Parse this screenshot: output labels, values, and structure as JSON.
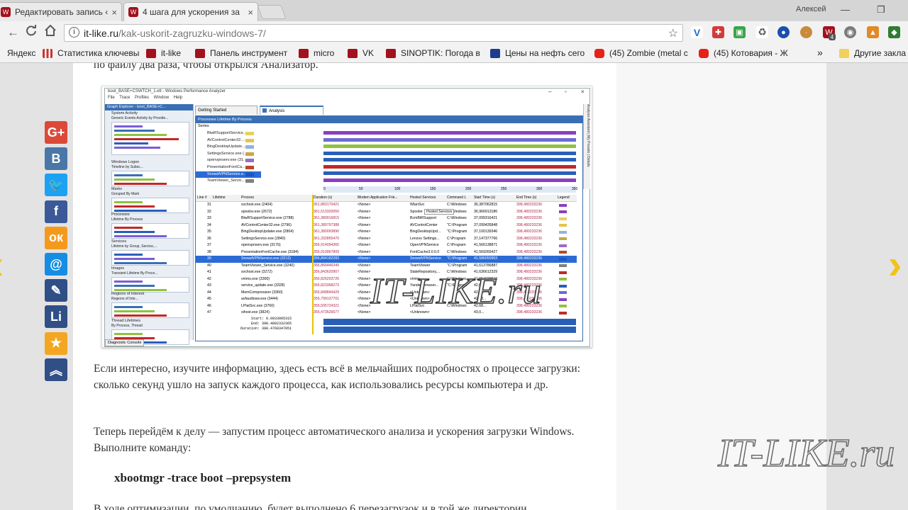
{
  "tabs": [
    {
      "title": "Редактировать запись ‹",
      "close": "×"
    },
    {
      "title": "4 шага для ускорения за",
      "close": "×"
    }
  ],
  "user": "Алексей",
  "window_controls": {
    "minimize": "—",
    "maximize": "❐"
  },
  "toolbar": {
    "back": "←",
    "forward": "→",
    "reload": "C",
    "home": "⌂",
    "url_host": "it-like.ru",
    "url_path": "/kak-uskorit-zagruzku-windows-7/",
    "star": "☆"
  },
  "extensions": [
    "vpn-extension",
    "shield-extension",
    "green-extension",
    "recycle-extension",
    "globe-extension",
    "cookie-extension",
    "badge-extension",
    "eye-extension",
    "fox-extension",
    "puzzle-extension",
    "menu"
  ],
  "ext_badge": "4",
  "bookmarks": [
    {
      "label": "Яндекс",
      "icon": "none"
    },
    {
      "label": "Статистика ключевы",
      "icon": "bars"
    },
    {
      "label": "it-like",
      "icon": "itlike"
    },
    {
      "label": "Панель инструмент",
      "icon": "itlike"
    },
    {
      "label": "micro",
      "icon": "itlike"
    },
    {
      "label": "VK",
      "icon": "itlike"
    },
    {
      "label": "SINOPTIK: Погода в",
      "icon": "itlike"
    },
    {
      "label": "Цены на нефть сего",
      "icon": "oil"
    },
    {
      "label": "(45) Zombie (metal с",
      "icon": "youtube"
    },
    {
      "label": "(45) Котовария - Ж",
      "icon": "youtube"
    }
  ],
  "bookmarks_more": "»",
  "other_bookmarks": "Другие закла",
  "article": {
    "top_partial": "по файлу два раза, чтобы открылся Анализатор.",
    "p1": "Если интересно, изучите информацию, здесь есть всё в мельчайших подробностях о процессе загрузки: сколько секунд ушло на запуск каждого процесса, как использовались ресурсы компьютера и др.",
    "p2": "Теперь перейдём к делу — запустим процесс автоматического анализа и ускорения загрузки Windows. Выполните команду:",
    "command": "xbootmgr -trace boot –prepsystem",
    "bottom_partial": "В ходе оптимизации, по умолчанию, будет выполнено 6 перезагрузок и в той же директории"
  },
  "wpa": {
    "title": "boot_BASE+CSWTCH_1.etl - Windows Performance Analyzer",
    "menu": "File Trace Profiles Window Help",
    "graph_explorer": "Graph Explorer - boot_BASE+C...",
    "sections": [
      {
        "name": "System Activity",
        "sub": "Generic Events   Activity by Provide..."
      },
      {
        "name": "Windows Logon",
        "sub": "Timeline by Subsc..."
      },
      {
        "name": "Marks",
        "sub": "Grouped By Mark"
      },
      {
        "name": "Processes",
        "sub": "Lifetime By Process"
      },
      {
        "name": "Services",
        "sub": "Lifetime by Group, Service,..."
      },
      {
        "name": "Images",
        "sub": "Transient Lifetime By Proce..."
      },
      {
        "name": "Regions of Interest",
        "sub": "Regions of Inte..."
      },
      {
        "name": "Thread Lifetimes",
        "sub": "By Process, Thread"
      }
    ],
    "diag": "Diagnostic Console",
    "tab_getting_started": "Getting Started",
    "tab_analysis": "Analysis",
    "inner_title": "Processes  Lifetime By Process",
    "series_label": "Series",
    "side_tabs": [
      "Analysis Assistant",
      "My Presets",
      "Details"
    ],
    "series": [
      {
        "name": "BtwRSupportService....",
        "color": "#e9d05a"
      },
      {
        "name": "AVControlCenter32....",
        "color": "#e6c34a"
      },
      {
        "name": "BingDesktopUpdate...",
        "color": "#8fb5e0"
      },
      {
        "name": "SettingsService.exe (...",
        "color": "#c8a840"
      },
      {
        "name": "openvpnserv.exe (31...",
        "color": "#9b6ac9"
      },
      {
        "name": "PresentationFontCa...",
        "color": "#b64a2a"
      },
      {
        "name": "SnowdVPNService.e...",
        "color": "#1e57c0",
        "selected": true
      },
      {
        "name": "TeamViewer_Servic...",
        "color": "#7f7f7f"
      }
    ],
    "bar_colors": [
      "#8a3fbf",
      "#6b6bd0",
      "#8fc240",
      "#2a5fb8",
      "#2a5fb8",
      "#c02828",
      "#2a5fb8",
      "#8a3fbf"
    ],
    "axis_ticks": [
      "0",
      "50",
      "100",
      "150",
      "200",
      "250",
      "300",
      "350"
    ],
    "columns": [
      "Line #",
      "Lifetime",
      "Process",
      "Duration (s)",
      "Modern Application Frie...",
      "Hosted Services",
      "Command L",
      "Start Time (s)",
      "End Time (s)",
      "Legend"
    ],
    "tooltip": "Hosted Services",
    "rows": [
      {
        "line": "31",
        "process": "svchost.exe (2404)",
        "dur": "361,883170421",
        "maf": "<None>",
        "host": "WlanSvc",
        "cmd": "C:\\Windows",
        "start": "36,387062815",
        "end": "398,480233236",
        "color": "#8a3fbf"
      },
      {
        "line": "32",
        "process": "spoolsv.exe (2672)",
        "dur": "361,513320050",
        "maf": "<None>",
        "host": "Spooler",
        "cmd": "C:\\Windows",
        "start": "36,966913186",
        "end": "398,480233236",
        "color": "#8a3fbf"
      },
      {
        "line": "33",
        "process": "BtwRSupportService.exe (2788)",
        "dur": "361,380916815",
        "maf": "<None>",
        "host": "BcmBtRSupport",
        "cmd": "C:\\Windows",
        "start": "37,099316421",
        "end": "398,480233236",
        "color": "#e9d05a"
      },
      {
        "line": "34",
        "process": "AVControlCenter32.exe (2796)",
        "dur": "361,380797388",
        "maf": "<None>",
        "host": "AVControlCenter",
        "cmd": "\"C:\\Program",
        "start": "37,099435848",
        "end": "398,480233236",
        "color": "#e6c34a"
      },
      {
        "line": "35",
        "process": "BingDesktopUpdater.exe (2804)",
        "dur": "361,380093890",
        "maf": "<None>",
        "host": "BingDesktopUpd...",
        "cmd": "\"C:\\Program",
        "start": "37,100139346",
        "end": "398,480233236",
        "color": "#8fb5e0"
      },
      {
        "line": "36",
        "process": "SettingsService.exe (2840)",
        "dur": "361,332855470",
        "maf": "<None>",
        "host": "Lenovo Settings...",
        "cmd": "C:\\Program",
        "start": "37,147377766",
        "end": "398,480233236",
        "color": "#c8a840"
      },
      {
        "line": "37",
        "process": "openvpnserv.exe (3176)",
        "dur": "356,914094365",
        "maf": "<None>",
        "host": "OpenVPNService",
        "cmd": "C:\\Program",
        "start": "41,566138871",
        "end": "398,480233236",
        "color": "#9b6ac9"
      },
      {
        "line": "38",
        "process": "PresentationFontCache.exe (3184)",
        "dur": "356,910967809",
        "maf": "<None>",
        "host": "FontCache3.0.0.0",
        "cmd": "C:\\Windows",
        "start": "41,569265427",
        "end": "398,480233236",
        "color": "#b64a2a"
      },
      {
        "line": "39",
        "process": "SnowdVPNService.exe (3212)",
        "dur": "356,894182283",
        "maf": "<None>",
        "host": "SnowdVPNService",
        "cmd": "\"C:\\Program",
        "start": "41,586050953",
        "end": "398,480233236",
        "color": "#1e57c0",
        "selected": true
      },
      {
        "line": "40",
        "process": "TeamViewer_Service.exe (3240)",
        "dur": "356,866446349",
        "maf": "<None>",
        "host": "TeamViewer",
        "cmd": "\"C:\\Program",
        "start": "41,613786887",
        "end": "398,480233236",
        "color": "#7f7f7f"
      },
      {
        "line": "41",
        "process": "svchost.exe (3272)",
        "dur": "356,843620907",
        "maf": "<None>",
        "host": "StateRepository,...",
        "cmd": "C:\\Windows",
        "start": "41,636612329",
        "end": "398,480233236",
        "color": "#c02828"
      },
      {
        "line": "42",
        "process": "vmms.exe (3300)",
        "dur": "356,826203726",
        "maf": "<None>",
        "host": "vmms",
        "cmd": "C:\\Windows",
        "start": "41,654029510",
        "end": "398,480233236",
        "color": "#8fc240"
      },
      {
        "line": "43",
        "process": "service_update.exe (3328)",
        "dur": "356,823368273",
        "maf": "<None>",
        "host": "YandexBrowser...",
        "cmd": "\"C:\\Program",
        "start": "42,6...",
        "end": "398,480233236",
        "color": "#2a5fb8"
      },
      {
        "line": "44",
        "process": "MemCompression (3360)",
        "dur": "355,848844429",
        "maf": "<None>",
        "host": "<Unknown>",
        "cmd": "",
        "start": "42,6...",
        "end": "398,480233236",
        "color": "#6b6bd0"
      },
      {
        "line": "45",
        "process": "avfaudiosw.exe (3444)",
        "dur": "355,799137701",
        "maf": "<None>",
        "host": "<Unknown>",
        "cmd": "",
        "start": "42,68...",
        "end": "398,480233236",
        "color": "#8a3fbf"
      },
      {
        "line": "46",
        "process": "LPlatSvc.exe (3760)",
        "dur": "355,505724321",
        "maf": "<None>",
        "host": "LPlatSvc",
        "cmd": "C:\\Windows",
        "start": "42,68...",
        "end": "398,480233236",
        "color": "#8fc240"
      },
      {
        "line": "47",
        "process": "sihost.exe (3824)",
        "dur": "355,473526677",
        "maf": "<None>",
        "host": "<Unknown>",
        "cmd": "",
        "start": "43,0...",
        "end": "398,480233236",
        "color": "#c02828"
      }
    ],
    "footer": {
      "start": "Start:   0.0033905315",
      "end": "End:  398.4802332365",
      "duration": "Duration:  398.4768347051"
    },
    "watermark": "IT-LIKE.ru"
  },
  "social": [
    {
      "name": "google-plus-share",
      "label": "G+",
      "color": "#db4a39"
    },
    {
      "name": "vk-share",
      "label": "B",
      "color": "#4a76a8"
    },
    {
      "name": "twitter-share",
      "label": "🐦",
      "color": "#1da1f2"
    },
    {
      "name": "facebook-share",
      "label": "f",
      "color": "#3b5998"
    },
    {
      "name": "odnoklassniki-share",
      "label": "ок",
      "color": "#f39a1d"
    },
    {
      "name": "mail-share",
      "label": "@",
      "color": "#168de2"
    },
    {
      "name": "livejournal-share",
      "label": "✎",
      "color": "#2f4f86"
    },
    {
      "name": "liveinternet-share",
      "label": "Li",
      "color": "#2f4f86"
    },
    {
      "name": "bookmark-share",
      "label": "★",
      "color": "#f4a623"
    },
    {
      "name": "more-share",
      "label": "︽",
      "color": "#2f4f86"
    }
  ],
  "nav_arrows": {
    "prev": "‹",
    "next": "›"
  },
  "watermark_big": "IT-LIKE.ru"
}
